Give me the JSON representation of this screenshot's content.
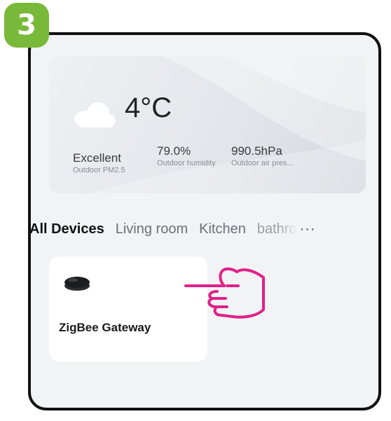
{
  "step": {
    "number": "3",
    "color": "#79b93a"
  },
  "weather": {
    "icon": "cloud-icon",
    "temperature": "4°C",
    "stats": [
      {
        "value": "Excellent",
        "label": "Outdoor PM2.5"
      },
      {
        "value": "79.0%",
        "label": "Outdoor humidity"
      },
      {
        "value": "990.5hPa",
        "label": "Outdoor air pres..."
      }
    ]
  },
  "tabs": [
    {
      "label": "All Devices",
      "active": true
    },
    {
      "label": "Living room",
      "active": false
    },
    {
      "label": "Kitchen",
      "active": false
    },
    {
      "label": "bathro",
      "active": false
    }
  ],
  "more": "···",
  "devices": [
    {
      "name": "ZigBee Gateway",
      "icon": "gateway-icon"
    }
  ],
  "pointer": {
    "icon": "pointing-hand-icon",
    "color": "#e0218a"
  }
}
